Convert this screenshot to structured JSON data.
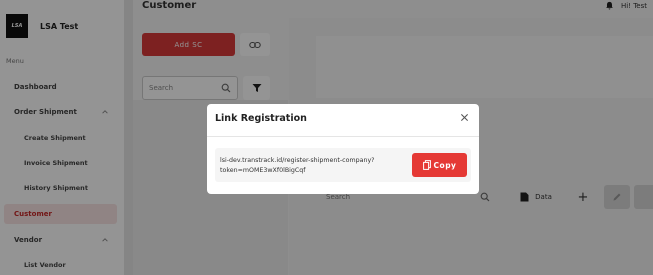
{
  "app": {
    "brand_name": "LSA Test",
    "logo_text": "LSA"
  },
  "sidebar": {
    "menu_label": "Menu",
    "items": [
      {
        "label": "Dashboard"
      },
      {
        "label": "Order Shipment"
      },
      {
        "label": "Create Shipment"
      },
      {
        "label": "Invoice Shipment"
      },
      {
        "label": "History Shipment"
      },
      {
        "label": "Customer"
      },
      {
        "label": "Vendor"
      },
      {
        "label": "List Vendor"
      }
    ]
  },
  "header": {
    "title": "Customer",
    "user_label": "Hi! Test"
  },
  "toolbar": {
    "add_label": "Add SC",
    "search_placeholder": "Search"
  },
  "table_toolbar": {
    "search_placeholder": "Search",
    "data_label": "Data",
    "plus_label": "+"
  },
  "modal": {
    "title": "Link Registration",
    "link_text": "lsi-dev.transtrack.id/register-shipment-company?token=mOME3wXf0lBigCqf",
    "copy_label": "Copy"
  },
  "colors": {
    "accent": "#e53935",
    "active_bg": "#f9e3e3",
    "active_text": "#c62828"
  }
}
